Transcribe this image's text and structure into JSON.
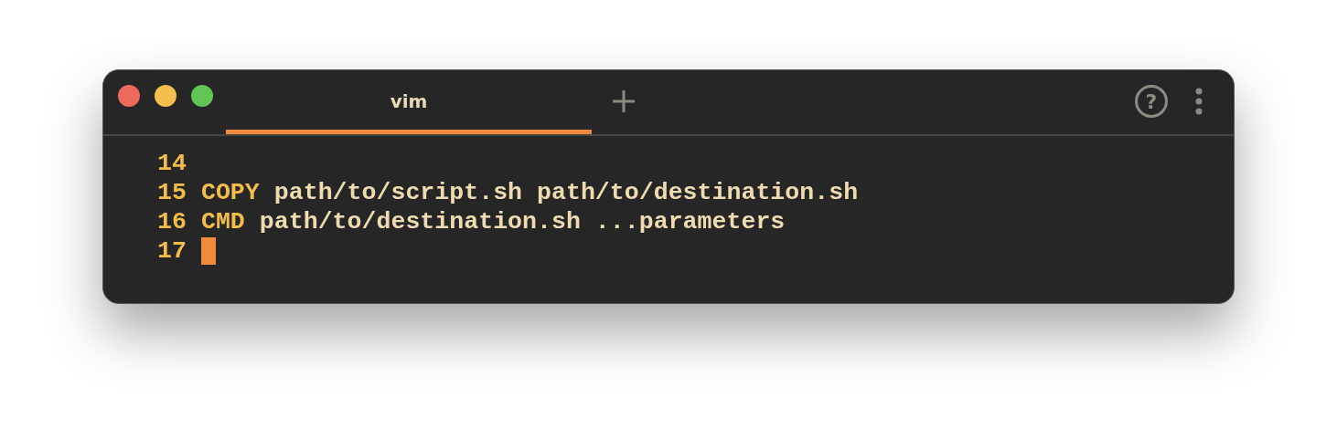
{
  "window": {
    "controls": [
      {
        "color": "#ee6a5e"
      },
      {
        "color": "#f5bf4f"
      },
      {
        "color": "#61c554"
      }
    ]
  },
  "tabs": [
    {
      "label": "vim",
      "selected": true
    }
  ],
  "toolbar": {
    "help": "?"
  },
  "editor": {
    "lines": [
      {
        "number": "14",
        "cursor": false
      },
      {
        "number": "15",
        "tokens": [
          {
            "kind": "keyword",
            "text": "COPY"
          },
          {
            "kind": "text",
            "text": "path/to/script.sh path/to/destination.sh"
          }
        ],
        "cursor": false
      },
      {
        "number": "16",
        "tokens": [
          {
            "kind": "keyword",
            "text": "CMD"
          },
          {
            "kind": "text",
            "text": "path/to/destination.sh ...parameters"
          }
        ],
        "cursor": false
      },
      {
        "number": "17",
        "cursor": true
      }
    ]
  }
}
